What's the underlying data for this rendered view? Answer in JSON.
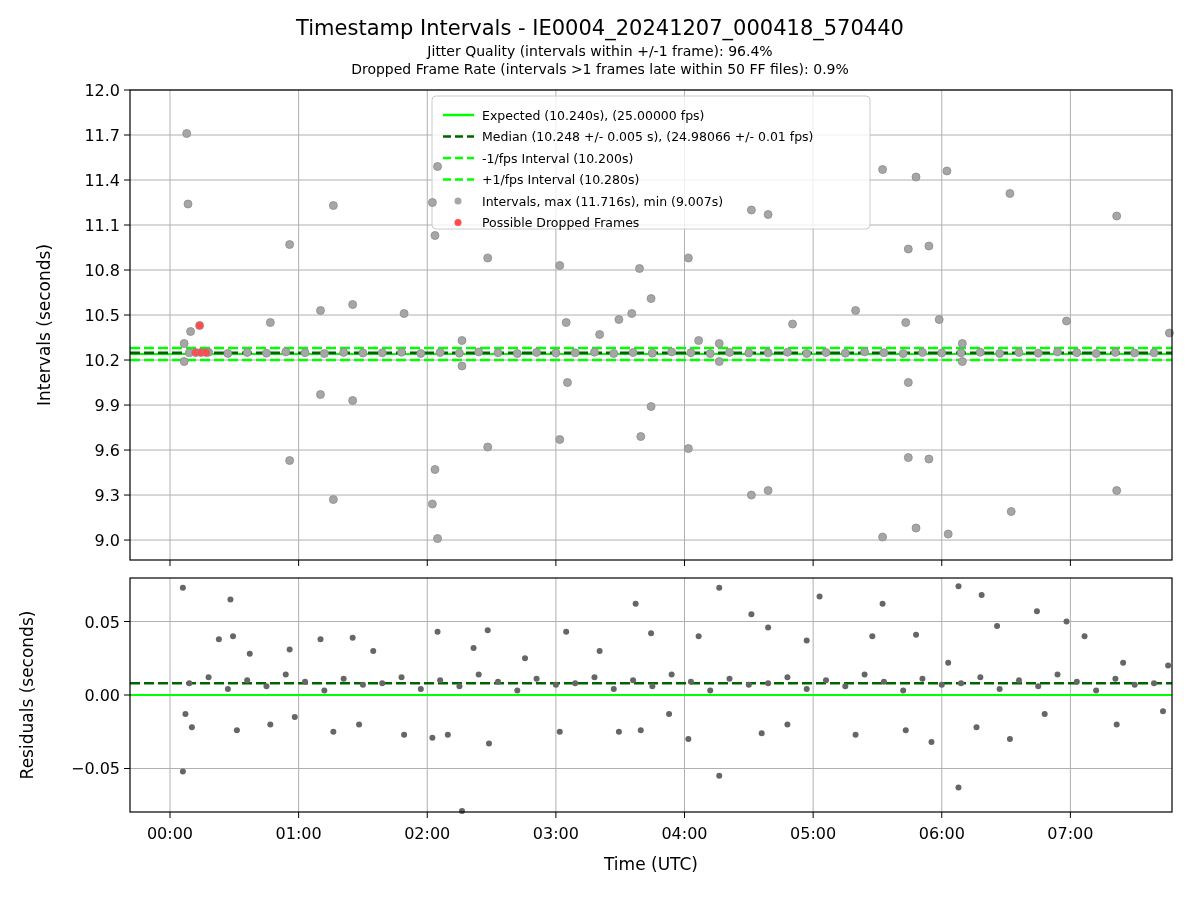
{
  "figure": {
    "title": "Timestamp Intervals - IE0004_20241207_000418_570440",
    "subtitle_lines": [
      "Jitter Quality (intervals within +/-1 frame): 96.4%",
      "Dropped Frame Rate (intervals >1 frames late within 50 FF files): 0.9%"
    ]
  },
  "intervals_panel": {
    "chart_data": {
      "type": "scatter",
      "ylabel": "Intervals (seconds)",
      "grid": true,
      "legend": true,
      "xlim": [
        -0.311,
        7.79
      ],
      "ylim": [
        8.867,
        12.0
      ],
      "yticks": [
        {
          "value": 9.0,
          "label": "9.0"
        },
        {
          "value": 9.3,
          "label": "9.3"
        },
        {
          "value": 9.6,
          "label": "9.6"
        },
        {
          "value": 9.9,
          "label": "9.9"
        },
        {
          "value": 10.2,
          "label": "10.2"
        },
        {
          "value": 10.5,
          "label": "10.5"
        },
        {
          "value": 10.8,
          "label": "10.8"
        },
        {
          "value": 11.1,
          "label": "11.1"
        },
        {
          "value": 11.4,
          "label": "11.4"
        },
        {
          "value": 11.7,
          "label": "11.7"
        },
        {
          "value": 12.0,
          "label": "12.0"
        }
      ],
      "series": [
        {
          "name": "Expected (10.240s), (25.00000 fps)",
          "type": "line",
          "line_style": "solid",
          "color": "#00ff00",
          "x": [
            -0.311,
            7.79
          ],
          "values": [
            10.24,
            10.24
          ]
        },
        {
          "name": "Median (10.248 +/- 0.005 s), (24.98066 +/- 0.01 fps)",
          "type": "line",
          "line_style": "dashed",
          "color": "#006400",
          "x": [
            -0.311,
            7.79
          ],
          "values": [
            10.248,
            10.248
          ]
        },
        {
          "name": "-1/fps Interval (10.200s)",
          "type": "line",
          "line_style": "dashed",
          "color": "#00ff00",
          "x": [
            -0.311,
            7.79
          ],
          "values": [
            10.2,
            10.2
          ]
        },
        {
          "name": "+1/fps Interval (10.280s)",
          "type": "line",
          "line_style": "dashed",
          "color": "#00ff00",
          "x": [
            -0.311,
            7.79
          ],
          "values": [
            10.28,
            10.28
          ]
        },
        {
          "name": "Intervals, max (11.716s), min (9.007s)",
          "type": "scatter",
          "color": "#a6a6a6",
          "x": [
            0.15,
            0.3,
            0.45,
            0.6,
            0.75,
            0.9,
            1.05,
            1.2,
            1.35,
            1.5,
            1.65,
            1.8,
            1.95,
            2.1,
            2.25,
            2.4,
            2.55,
            2.7,
            2.85,
            3.0,
            3.15,
            3.3,
            3.45,
            3.6,
            3.75,
            3.9,
            4.05,
            4.2,
            4.35,
            4.5,
            4.65,
            4.8,
            4.95,
            5.1,
            5.25,
            5.4,
            5.55,
            5.7,
            5.85,
            6.0,
            6.15,
            6.3,
            6.45,
            6.6,
            6.75,
            6.9,
            7.05,
            7.2,
            7.35,
            7.5,
            7.65,
            0.13,
            0.14,
            0.16,
            0.11,
            0.11,
            0.93,
            0.93,
            1.17,
            1.17,
            1.27,
            1.27,
            1.42,
            1.42,
            1.82,
            0.78,
            2.04,
            2.06,
            2.08,
            2.06,
            2.04,
            2.08,
            2.27,
            2.27,
            2.47,
            2.47,
            3.03,
            3.03,
            3.08,
            3.09,
            3.34,
            3.49,
            3.59,
            3.65,
            3.66,
            3.74,
            3.74,
            4.03,
            4.03,
            4.11,
            4.27,
            4.27,
            4.52,
            4.52,
            4.65,
            4.65,
            4.84,
            5.33,
            5.54,
            5.54,
            5.72,
            5.74,
            5.74,
            5.74,
            5.8,
            5.8,
            5.9,
            5.9,
            5.98,
            6.04,
            6.05,
            6.16,
            6.16,
            6.53,
            6.54,
            6.97,
            7.36,
            7.36,
            7.77
          ],
          "values": [
            10.248,
            10.252,
            10.244,
            10.25,
            10.246,
            10.254,
            10.249,
            10.243,
            10.251,
            10.247,
            10.248,
            10.252,
            10.244,
            10.25,
            10.246,
            10.254,
            10.249,
            10.243,
            10.251,
            10.247,
            10.248,
            10.252,
            10.244,
            10.25,
            10.246,
            10.254,
            10.249,
            10.243,
            10.251,
            10.247,
            10.248,
            10.252,
            10.244,
            10.25,
            10.246,
            10.254,
            10.249,
            10.243,
            10.251,
            10.247,
            10.248,
            10.252,
            10.244,
            10.25,
            10.246,
            10.254,
            10.249,
            10.243,
            10.251,
            10.247,
            10.248,
            11.71,
            11.24,
            10.39,
            10.31,
            10.19,
            10.97,
            9.53,
            10.53,
            9.97,
            11.23,
            9.27,
            10.57,
            9.93,
            10.51,
            10.45,
            11.25,
            11.03,
            11.49,
            9.47,
            9.24,
            9.01,
            10.33,
            10.16,
            10.88,
            9.62,
            10.83,
            9.67,
            10.45,
            10.05,
            10.37,
            10.47,
            10.51,
            10.81,
            9.69,
            10.61,
            9.89,
            10.88,
            9.61,
            10.33,
            10.31,
            10.19,
            11.2,
            9.3,
            11.17,
            9.33,
            10.44,
            10.53,
            11.47,
            9.02,
            10.45,
            10.94,
            10.05,
            9.55,
            11.42,
            9.08,
            10.96,
            9.54,
            10.47,
            11.46,
            9.04,
            10.31,
            10.19,
            11.31,
            9.19,
            10.46,
            11.16,
            9.33,
            10.38
          ]
        },
        {
          "name": "Possible Dropped Frames",
          "type": "scatter",
          "color": "#ff4d4d",
          "x": [
            0.2,
            0.24,
            0.28,
            0.23
          ],
          "values": [
            10.25,
            10.25,
            10.25,
            10.43
          ]
        }
      ]
    }
  },
  "residuals_panel": {
    "chart_data": {
      "type": "scatter",
      "xlabel": "Time (UTC)",
      "ylabel": "Residuals (seconds)",
      "grid": true,
      "xlim": [
        -0.311,
        7.79
      ],
      "ylim": [
        -0.0796,
        0.0796
      ],
      "xticks": [
        {
          "value": 0,
          "label": "00:00"
        },
        {
          "value": 1,
          "label": "01:00"
        },
        {
          "value": 2,
          "label": "02:00"
        },
        {
          "value": 3,
          "label": "03:00"
        },
        {
          "value": 4,
          "label": "04:00"
        },
        {
          "value": 5,
          "label": "05:00"
        },
        {
          "value": 6,
          "label": "06:00"
        },
        {
          "value": 7,
          "label": "07:00"
        }
      ],
      "yticks": [
        {
          "value": -0.05,
          "label": "−0.05"
        },
        {
          "value": 0,
          "label": "0.00"
        },
        {
          "value": 0.05,
          "label": "0.05"
        }
      ],
      "series": [
        {
          "type": "line",
          "line_style": "solid",
          "color": "#00ff00",
          "x": [
            -0.311,
            7.79
          ],
          "values": [
            0,
            0
          ]
        },
        {
          "type": "line",
          "line_style": "dashed",
          "color": "#006400",
          "x": [
            -0.311,
            7.79
          ],
          "values": [
            0.008,
            0.008
          ]
        },
        {
          "type": "scatter",
          "color": "#666666",
          "x": [
            0.15,
            0.3,
            0.45,
            0.6,
            0.75,
            0.9,
            1.05,
            1.2,
            1.35,
            1.5,
            1.65,
            1.8,
            1.95,
            2.1,
            2.25,
            2.4,
            2.55,
            2.7,
            2.85,
            3.0,
            3.15,
            3.3,
            3.45,
            3.6,
            3.75,
            3.9,
            4.05,
            4.2,
            4.35,
            4.5,
            4.65,
            4.8,
            4.95,
            5.1,
            5.25,
            5.4,
            5.55,
            5.7,
            5.85,
            6.0,
            6.15,
            6.3,
            6.45,
            6.6,
            6.75,
            6.9,
            7.05,
            7.2,
            7.35,
            7.5,
            7.65,
            0.1,
            0.1,
            0.12,
            0.17,
            0.38,
            0.47,
            0.49,
            0.52,
            0.62,
            0.78,
            0.93,
            0.97,
            1.17,
            1.27,
            1.42,
            1.47,
            1.58,
            1.82,
            2.04,
            2.08,
            2.16,
            2.27,
            2.36,
            2.47,
            2.48,
            2.76,
            3.03,
            3.08,
            3.34,
            3.49,
            3.62,
            3.66,
            3.74,
            3.88,
            4.03,
            4.11,
            4.27,
            4.27,
            4.52,
            4.6,
            4.65,
            4.8,
            4.95,
            5.05,
            5.33,
            5.46,
            5.54,
            5.72,
            5.8,
            5.92,
            6.05,
            6.13,
            6.13,
            6.27,
            6.31,
            6.43,
            6.53,
            6.74,
            6.8,
            6.97,
            7.11,
            7.36,
            7.41,
            7.72,
            7.76
          ],
          "values": [
            0.008,
            0.012,
            0.004,
            0.01,
            0.006,
            0.014,
            0.009,
            0.003,
            0.011,
            0.007,
            0.008,
            0.012,
            0.004,
            0.01,
            0.006,
            0.014,
            0.009,
            0.003,
            0.011,
            0.007,
            0.008,
            0.012,
            0.004,
            0.01,
            0.006,
            0.014,
            0.009,
            0.003,
            0.011,
            0.007,
            0.008,
            0.012,
            0.004,
            0.01,
            0.006,
            0.014,
            0.009,
            0.003,
            0.011,
            0.007,
            0.008,
            0.012,
            0.004,
            0.01,
            0.006,
            0.014,
            0.009,
            0.003,
            0.011,
            0.007,
            0.008,
            0.073,
            -0.052,
            -0.013,
            -0.022,
            0.038,
            0.065,
            0.04,
            -0.024,
            0.028,
            -0.02,
            0.031,
            -0.015,
            0.038,
            -0.025,
            0.039,
            -0.02,
            0.03,
            -0.027,
            -0.029,
            0.043,
            -0.027,
            -0.079,
            0.032,
            0.044,
            -0.033,
            0.025,
            -0.025,
            0.043,
            0.03,
            -0.025,
            0.062,
            -0.024,
            0.042,
            -0.013,
            -0.03,
            0.04,
            0.073,
            -0.055,
            0.055,
            -0.026,
            0.046,
            -0.02,
            0.037,
            0.067,
            -0.027,
            0.04,
            0.062,
            -0.024,
            0.041,
            -0.032,
            0.022,
            0.074,
            -0.063,
            -0.022,
            0.068,
            0.047,
            -0.03,
            0.057,
            -0.013,
            0.05,
            0.04,
            -0.02,
            0.022,
            -0.011,
            0.02
          ]
        }
      ]
    }
  }
}
